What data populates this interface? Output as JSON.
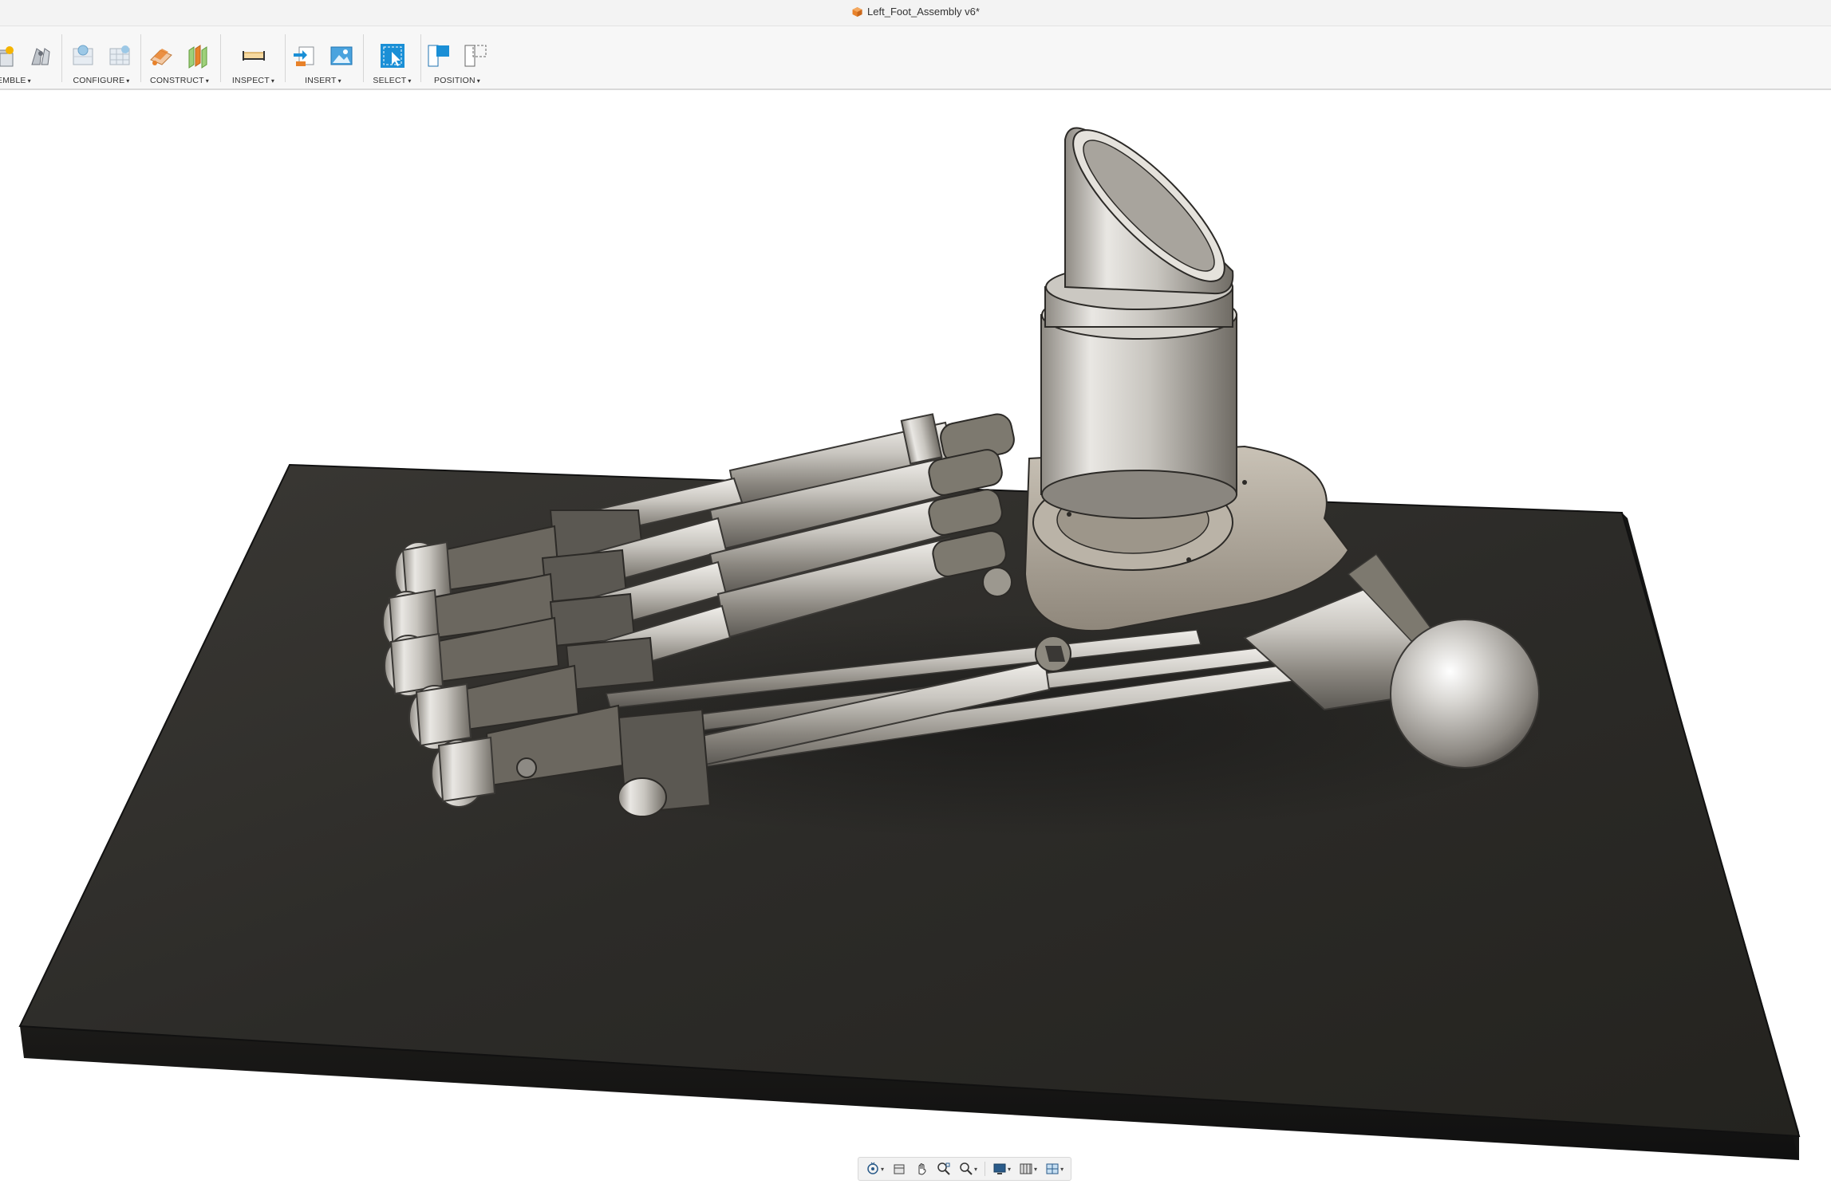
{
  "window": {
    "title": "Left_Foot_Assembly v6*",
    "doc_icon": "orange-box-icon"
  },
  "toolbar": {
    "groups": [
      {
        "label": "EMBLE",
        "icons": [
          "new-component-icon",
          "joint-icon"
        ]
      },
      {
        "label": "CONFIGURE",
        "icons": [
          "configure-table-icon",
          "configure-grid-icon"
        ]
      },
      {
        "label": "CONSTRUCT",
        "icons": [
          "offset-plane-icon",
          "midplane-icon"
        ]
      },
      {
        "label": "INSPECT",
        "icons": [
          "measure-icon"
        ]
      },
      {
        "label": "INSERT",
        "icons": [
          "insert-derive-icon",
          "insert-image-icon"
        ]
      },
      {
        "label": "SELECT",
        "icons": [
          "select-icon"
        ]
      },
      {
        "label": "POSITION",
        "icons": [
          "capture-position-icon",
          "revert-position-icon"
        ]
      }
    ],
    "caret": "▾"
  },
  "colors": {
    "accent_orange": "#e8822a",
    "select_blue": "#1a8fd6",
    "base_plate": "#2b2a28",
    "metal_light": "#d9d6d0",
    "metal_dark": "#6a665f"
  },
  "navbar": {
    "tools": [
      "orbit-icon",
      "look-at-icon",
      "pan-icon",
      "zoom-fit-icon",
      "zoom-icon",
      "display-settings-icon",
      "grid-settings-icon",
      "viewports-icon"
    ]
  }
}
